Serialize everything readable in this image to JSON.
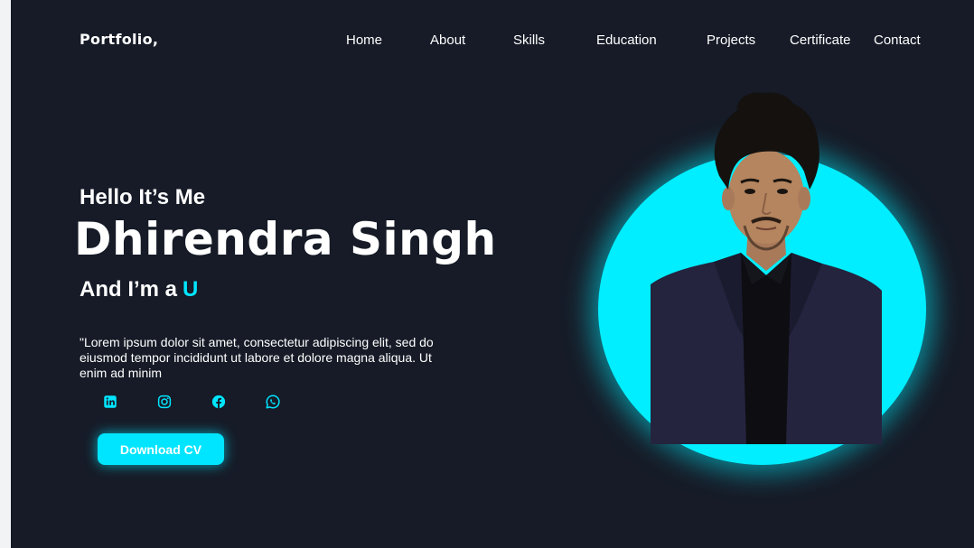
{
  "header": {
    "logo": "Portfolio,"
  },
  "nav": {
    "items": [
      {
        "label": "Home"
      },
      {
        "label": "About"
      },
      {
        "label": "Skills"
      },
      {
        "label": "Education"
      },
      {
        "label": "Projects"
      },
      {
        "label": "Certificate"
      },
      {
        "label": "Contact"
      }
    ]
  },
  "hero": {
    "greeting": "Hello It’s Me",
    "name": "Dhirendra Singh",
    "role_prefix": "And I’m a",
    "role_value": "U",
    "description": "\"Lorem ipsum dolor sit amet, consectetur adipiscing elit, sed do eiusmod tempor incididunt ut labore et dolore magna aliqua. Ut enim ad minim",
    "cta_label": "Download CV"
  },
  "social": [
    {
      "icon": "linkedin-icon"
    },
    {
      "icon": "instagram-icon"
    },
    {
      "icon": "facebook-icon"
    },
    {
      "icon": "whatsapp-icon"
    }
  ],
  "colors": {
    "background": "#161b27",
    "accent": "#00e5ff",
    "text": "#ffffff"
  }
}
